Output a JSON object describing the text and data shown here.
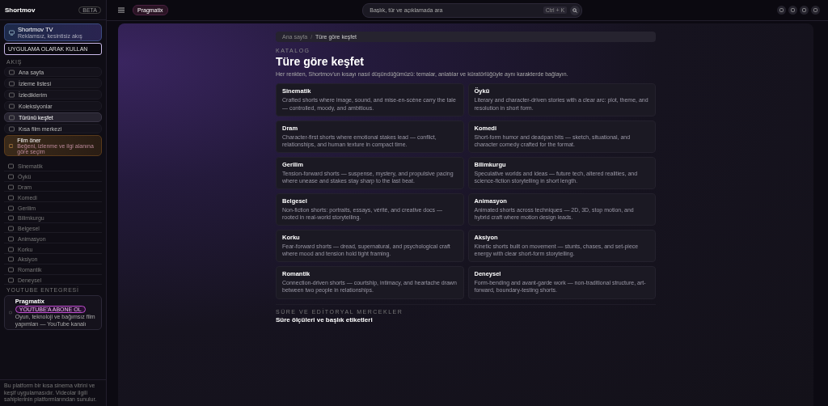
{
  "sidebar": {
    "logo": "Shortmov",
    "badge": "BETA",
    "tv_card": {
      "title": "Shortmov TV",
      "subtitle": "Reklamsız, kesintisiz akış"
    },
    "app_button": "UYGULAMA OLARAK KULLAN",
    "section_label": "AKIŞ",
    "nav_items": [
      {
        "label": "Ana sayfa",
        "selected": false,
        "kind": "link"
      },
      {
        "label": "İzleme listesi",
        "selected": false,
        "kind": "link"
      },
      {
        "label": "İzlediklerim",
        "selected": false,
        "kind": "link"
      },
      {
        "label": "Koleksiyonlar",
        "selected": false,
        "kind": "link"
      },
      {
        "label": "Türünü keşfet",
        "selected": true,
        "kind": "link"
      },
      {
        "label": "Kısa film merkezi",
        "selected": false,
        "kind": "link"
      },
      {
        "label": "Film öner",
        "subtitle": "Beğeni, izlenme ve ilgi alanına göre seçim",
        "selected": false,
        "kind": "highlight"
      }
    ],
    "genre_items": [
      "Sinematik",
      "Öykü",
      "Dram",
      "Komedi",
      "Gerilim",
      "Bilimkurgu",
      "Belgesel",
      "Animasyon",
      "Korku",
      "Aksiyon",
      "Romantik",
      "Deneysel"
    ],
    "youtube_label": "YOUTUBE ENTEGRESİ",
    "youtube_card": {
      "title": "Pragmatix",
      "button": "YOUTUBE'A ABONE OL",
      "text": "Oyun, teknoloji ve bağımsız film yapımları — YouTube kanalı"
    },
    "footer": "Bu platform bir kısa sinema vitrini ve keşif uygulamasıdır. Videolar ilgili sahiplerinin platformlarından sunulur."
  },
  "topbar": {
    "chip": "Pragmatix",
    "search": {
      "placeholder": "Başlık, tür ve açıklamada ara"
    },
    "shortcut": "Ctrl + K"
  },
  "breadcrumb": [
    "Ana sayfa",
    "Türe göre keşfet"
  ],
  "breadcrumb_separator": "/",
  "eyebrow": "KATALOG",
  "title": "Türe göre keşfet",
  "description": "Her renkten, Shortmov'un kısayı nasıl düşündüğümüzü: temalar, anlatılar ve küratörlüğüyle aynı karakterde bağlayın.",
  "genres": [
    {
      "name": "Sinematik",
      "text": "Crafted shorts where image, sound, and mise-en-scène carry the tale — controlled, moody, and ambitious."
    },
    {
      "name": "Öykü",
      "text": "Literary and character-driven stories with a clear arc: plot, theme, and resolution in short form."
    },
    {
      "name": "Dram",
      "text": "Character-first shorts where emotional stakes lead — conflict, relationships, and human texture in compact time."
    },
    {
      "name": "Komedi",
      "text": "Short-form humor and deadpan bits — sketch, situational, and character comedy crafted for the format."
    },
    {
      "name": "Gerilim",
      "text": "Tension-forward shorts — suspense, mystery, and propulsive pacing where unease and stakes stay sharp to the last beat."
    },
    {
      "name": "Bilimkurgu",
      "text": "Speculative worlds and ideas — future tech, altered realities, and science-fiction storytelling in short length."
    },
    {
      "name": "Belgesel",
      "text": "Non-fiction shorts: portraits, essays, vérité, and creative docs — rooted in real-world storytelling."
    },
    {
      "name": "Animasyon",
      "text": "Animated shorts across techniques — 2D, 3D, stop motion, and hybrid craft where motion design leads."
    },
    {
      "name": "Korku",
      "text": "Fear-forward shorts — dread, supernatural, and psychological craft where mood and tension hold tight framing."
    },
    {
      "name": "Aksiyon",
      "text": "Kinetic shorts built on movement — stunts, chases, and set-piece energy with clear short-form storytelling."
    },
    {
      "name": "Romantik",
      "text": "Connection-driven shorts — courtship, intimacy, and heartache drawn between two people in relationships."
    },
    {
      "name": "Deneysel",
      "text": "Form-bending and avant-garde work — non-traditional structure, art-forward, boundary-testing shorts."
    }
  ],
  "lens": {
    "eyebrow": "SÜRE VE EDİTORYAL MERCEKLER",
    "title": "Süre ölçüleri ve başlık etiketleri"
  }
}
